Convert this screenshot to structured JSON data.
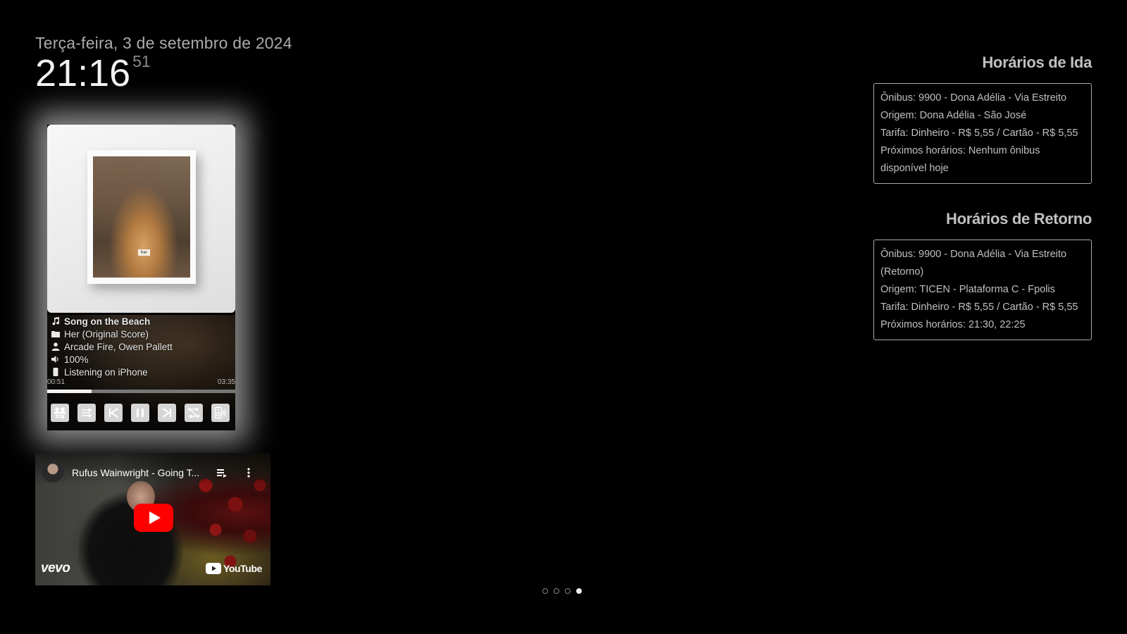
{
  "clock": {
    "date": "Terça-feira, 3 de setembro de 2024",
    "time": "21:16",
    "seconds": "51"
  },
  "spotify": {
    "track": "Song on the Beach",
    "album": "Her (Original Score)",
    "artist": "Arcade Fire, Owen Pallett",
    "volume": "100%",
    "device": "Listening on iPhone",
    "cover_tag": "her",
    "elapsed": "00:51",
    "duration": "03:35",
    "progress_fraction": 0.237,
    "controls": [
      "devices-icon",
      "shuffle-icon",
      "previous-icon",
      "pause-icon",
      "next-icon",
      "repeat-off-icon",
      "speaker-icon"
    ]
  },
  "youtube": {
    "title": "Rufus Wainwright - Going T...",
    "vevo": "vevo",
    "logo": "YouTube"
  },
  "pages": {
    "count": 4,
    "active_index": 3
  },
  "bus": {
    "ida": {
      "heading": "Horários de Ida",
      "line": "Ônibus: 9900 - Dona Adélia - Via Estreito",
      "origin": "Origem: Dona Adélia - São José",
      "fare": "Tarifa: Dinheiro - R$ 5,55 / Cartão - R$ 5,55",
      "next": "Próximos horários: Nenhum ônibus disponível hoje"
    },
    "retorno": {
      "heading": "Horários de Retorno",
      "line": "Ônibus: 9900 - Dona Adélia - Via Estreito (Retorno)",
      "origin": "Origem: TICEN - Plataforma C - Fpolis",
      "fare": "Tarifa: Dinheiro - R$ 5,55 / Cartão - R$ 5,55",
      "next": "Próximos horários: 21:30, 22:25"
    }
  },
  "colors": {
    "background": "#000000",
    "text": "#c0c0c0",
    "youtube_red": "#ff0000"
  }
}
